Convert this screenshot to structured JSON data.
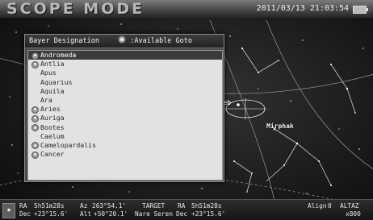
{
  "header": {
    "mode_title": "SCOPE MODE",
    "datetime": "2011/03/13 21:03:54"
  },
  "panel": {
    "title": "Bayer Designation",
    "legend": ":Available Goto",
    "items": [
      {
        "label": "Andromeda",
        "goto": true,
        "selected": true
      },
      {
        "label": "Antlia",
        "goto": true,
        "selected": false
      },
      {
        "label": "Apus",
        "goto": false,
        "selected": false
      },
      {
        "label": "Aquarius",
        "goto": false,
        "selected": false
      },
      {
        "label": "Aquila",
        "goto": false,
        "selected": false
      },
      {
        "label": "Ara",
        "goto": false,
        "selected": false
      },
      {
        "label": "Aries",
        "goto": true,
        "selected": false
      },
      {
        "label": "Auriga",
        "goto": true,
        "selected": false
      },
      {
        "label": "Bootes",
        "goto": true,
        "selected": false
      },
      {
        "label": "Caelum",
        "goto": false,
        "selected": false
      },
      {
        "label": "Camelopardalis",
        "goto": true,
        "selected": false
      },
      {
        "label": "Cancer",
        "goto": true,
        "selected": false
      }
    ]
  },
  "sky": {
    "labels": [
      "Deneb",
      "Mirphak"
    ]
  },
  "status": {
    "ra_label": "RA",
    "ra_value": "5h51m28s",
    "dec_label": "Dec",
    "dec_value": "+23°15.6'",
    "az_label": "Az",
    "az_value": "263°54.1'",
    "alt_label": "Alt",
    "alt_value": "+50°20.1'",
    "target_label": "TARGET",
    "target_name": "Nare Seren",
    "target_ra_label": "RA",
    "target_ra_value": "5h51m28s",
    "target_dec_label": "Dec",
    "target_dec_value": "+23°15.6'",
    "align_label": "Align",
    "align_value": "0",
    "mount": "ALTAZ",
    "zoom": "x800"
  },
  "colors": {
    "panel_bg": "#4a4a4a",
    "list_bg": "#e2e2e2",
    "selected_row": "#3c3c3c"
  }
}
